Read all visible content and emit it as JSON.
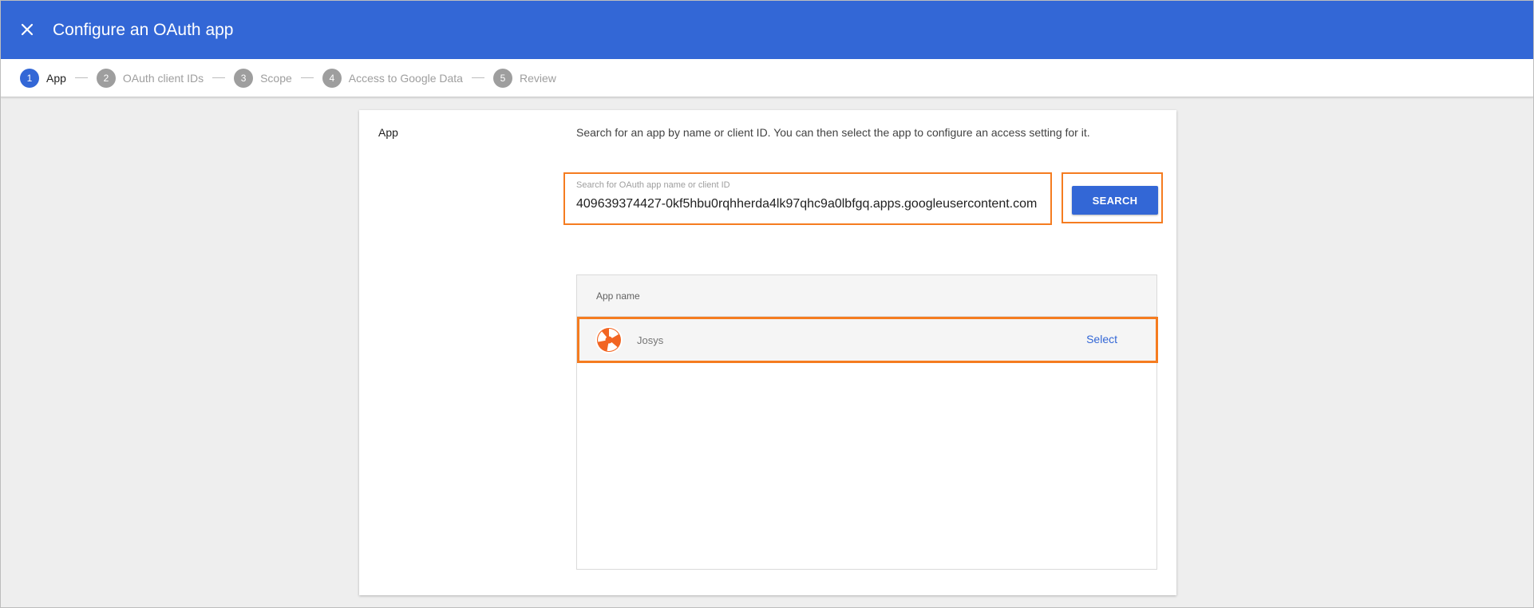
{
  "header": {
    "title": "Configure an OAuth app"
  },
  "steps": [
    {
      "num": "1",
      "label": "App"
    },
    {
      "num": "2",
      "label": "OAuth client IDs"
    },
    {
      "num": "3",
      "label": "Scope"
    },
    {
      "num": "4",
      "label": "Access to Google Data"
    },
    {
      "num": "5",
      "label": "Review"
    }
  ],
  "card": {
    "section_label": "App",
    "description": "Search for an app by name or client ID. You can then select the app to configure an access setting for it.",
    "search": {
      "placeholder": "Search for OAuth app name or client ID",
      "value": "409639374427-0kf5hbu0rqhherda4lk97qhc9a0lbfgq.apps.googleusercontent.com",
      "button_label": "SEARCH"
    },
    "results": {
      "column_header": "App name",
      "rows": [
        {
          "app_name": "Josys",
          "action_label": "Select"
        }
      ]
    }
  },
  "colors": {
    "primary": "#3367d6",
    "highlight": "#f57c20",
    "logo": "#f26522"
  }
}
